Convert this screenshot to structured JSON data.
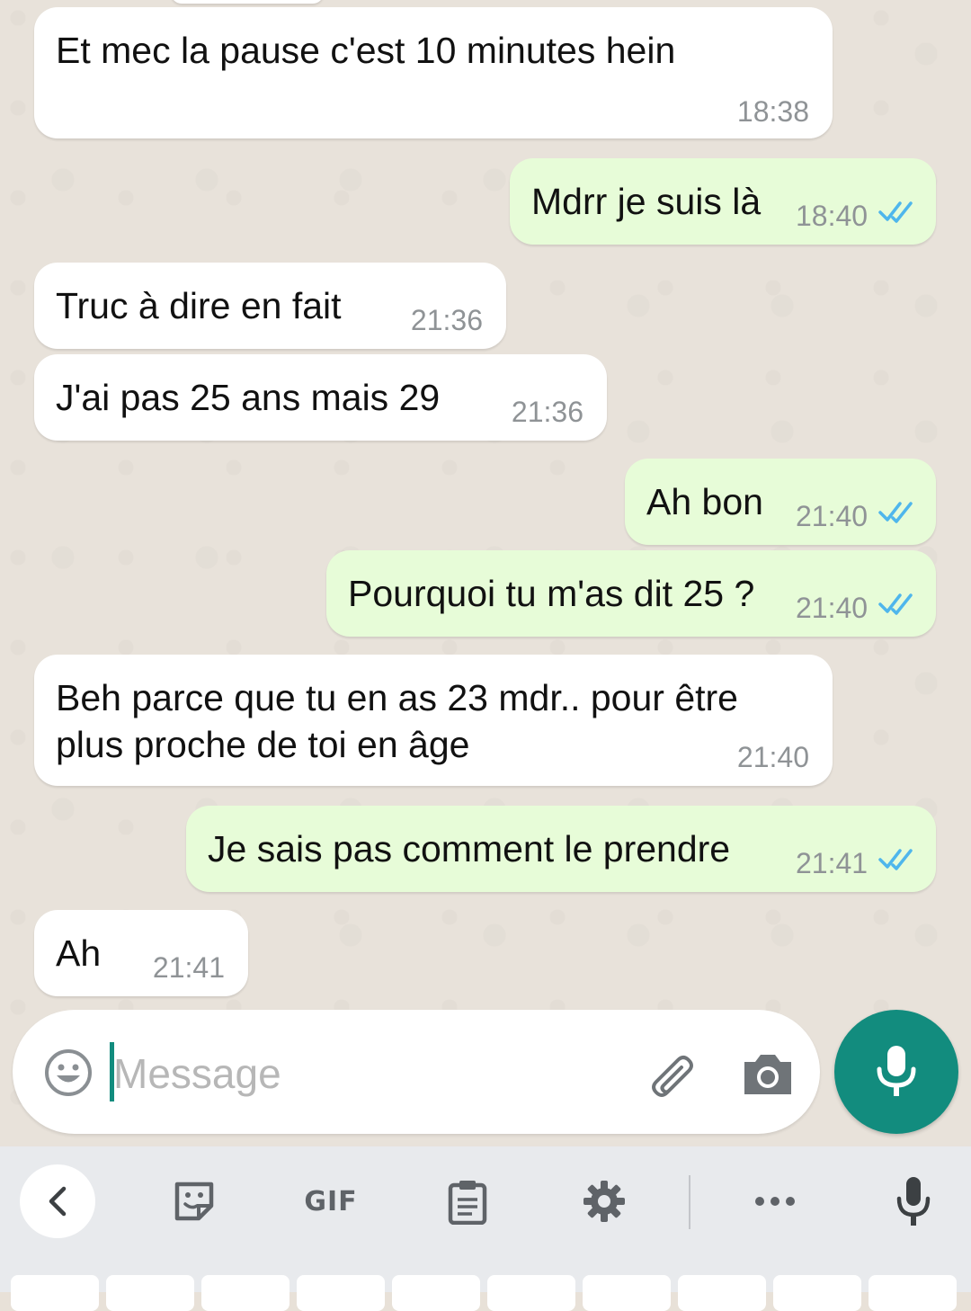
{
  "messages": [
    {
      "dir": "in",
      "text": "Et mec la pause c'est 10 minutes hein",
      "time": "18:38"
    },
    {
      "dir": "out",
      "text": "Mdrr je suis là",
      "time": "18:40",
      "status": "read"
    },
    {
      "dir": "in",
      "text": "Truc à dire en fait",
      "time": "21:36"
    },
    {
      "dir": "in",
      "text": "J'ai pas 25 ans mais 29",
      "time": "21:36"
    },
    {
      "dir": "out",
      "text": "Ah bon",
      "time": "21:40",
      "status": "read"
    },
    {
      "dir": "out",
      "text": "Pourquoi tu m'as dit 25 ?",
      "time": "21:40",
      "status": "read"
    },
    {
      "dir": "in",
      "text": "Beh parce que tu en as 23 mdr.. pour être\nplus proche de toi en âge",
      "time": "21:40"
    },
    {
      "dir": "out",
      "text": "Je sais pas comment le prendre",
      "time": "21:41",
      "status": "read"
    },
    {
      "dir": "in",
      "text": "Ah",
      "time": "21:41"
    }
  ],
  "composer": {
    "placeholder": "Message",
    "icons": [
      "emoji-icon",
      "paperclip-icon",
      "camera-icon"
    ]
  },
  "send_button": {
    "icon": "microphone-icon"
  },
  "keyboard_toolbar": {
    "items": [
      "back-arrow-icon",
      "sticker-icon",
      "GIF",
      "clipboard-icon",
      "gear-icon",
      "more-icon",
      "microphone-icon"
    ],
    "gif_label": "GIF"
  },
  "colors": {
    "chat_bg": "#e8e2da",
    "incoming_bubble": "#ffffff",
    "outgoing_bubble": "#e7fcd8",
    "read_ticks": "#4fb6ec",
    "accent": "#128c7e",
    "keyboard_bg": "#e8eaed"
  }
}
